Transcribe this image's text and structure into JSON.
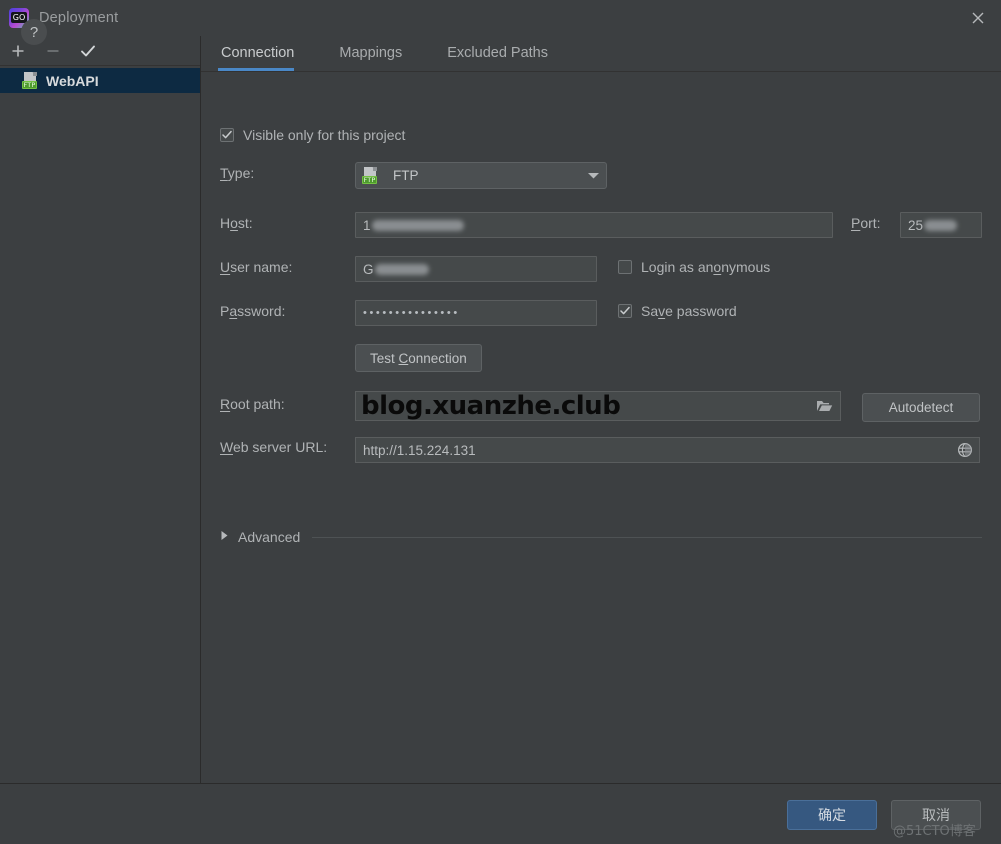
{
  "window": {
    "title": "Deployment",
    "close_icon": "close-icon",
    "app_icon": "goland-logo-icon",
    "app_icon_text": "GO"
  },
  "sidebar": {
    "toolbar": [
      {
        "name": "add",
        "icon": "plus-icon",
        "enabled": true
      },
      {
        "name": "remove",
        "icon": "minus-icon",
        "enabled": false
      },
      {
        "name": "set-default",
        "icon": "check-icon",
        "enabled": true
      }
    ],
    "items": [
      {
        "label": "WebAPI",
        "icon": "ftp-server-icon",
        "badge": "FTP",
        "selected": true
      }
    ]
  },
  "tabs": [
    {
      "label": "Connection",
      "active": true
    },
    {
      "label": "Mappings",
      "active": false
    },
    {
      "label": "Excluded Paths",
      "active": false
    }
  ],
  "form": {
    "visible_only_checkbox": {
      "label": "Visible only for this project",
      "checked": true
    },
    "type": {
      "label": "Type:",
      "value": "FTP",
      "icon": "ftp-server-icon",
      "badge": "FTP",
      "caret": "chevron-down-icon"
    },
    "host": {
      "label": "Host:",
      "value": "1",
      "redacted": true
    },
    "port": {
      "label": "Port:",
      "value": "25",
      "redacted": true
    },
    "user_name": {
      "label": "User name:",
      "value": "G",
      "redacted": true
    },
    "login_anonymous": {
      "label": "Login as anonymous",
      "checked": false
    },
    "password": {
      "label": "Password:",
      "value": "•••••••••••••••"
    },
    "save_password": {
      "label": "Save password",
      "checked": true
    },
    "test_connection": {
      "label": "Test Connection"
    },
    "root_path": {
      "label": "Root path:",
      "value": "blog.xuanzhe.club",
      "browse_icon": "folder-icon"
    },
    "autodetect": {
      "label": "Autodetect"
    },
    "web_server_url": {
      "label": "Web server URL:",
      "value": "http://1.15.224.131",
      "open_icon": "globe-icon"
    },
    "advanced": {
      "label": "Advanced",
      "expanded": false,
      "icon": "triangle-right-icon"
    }
  },
  "footer": {
    "help": {
      "label": "?",
      "icon": "help-icon"
    },
    "ok_label": "确定",
    "cancel_label": "取消",
    "watermark": "@51CTO博客"
  },
  "colors": {
    "background": "#3c3f41",
    "accent": "#4a88c7",
    "selection": "#0d2a42",
    "primary_button": "#365880",
    "badge_green": "#4f9b2f"
  }
}
